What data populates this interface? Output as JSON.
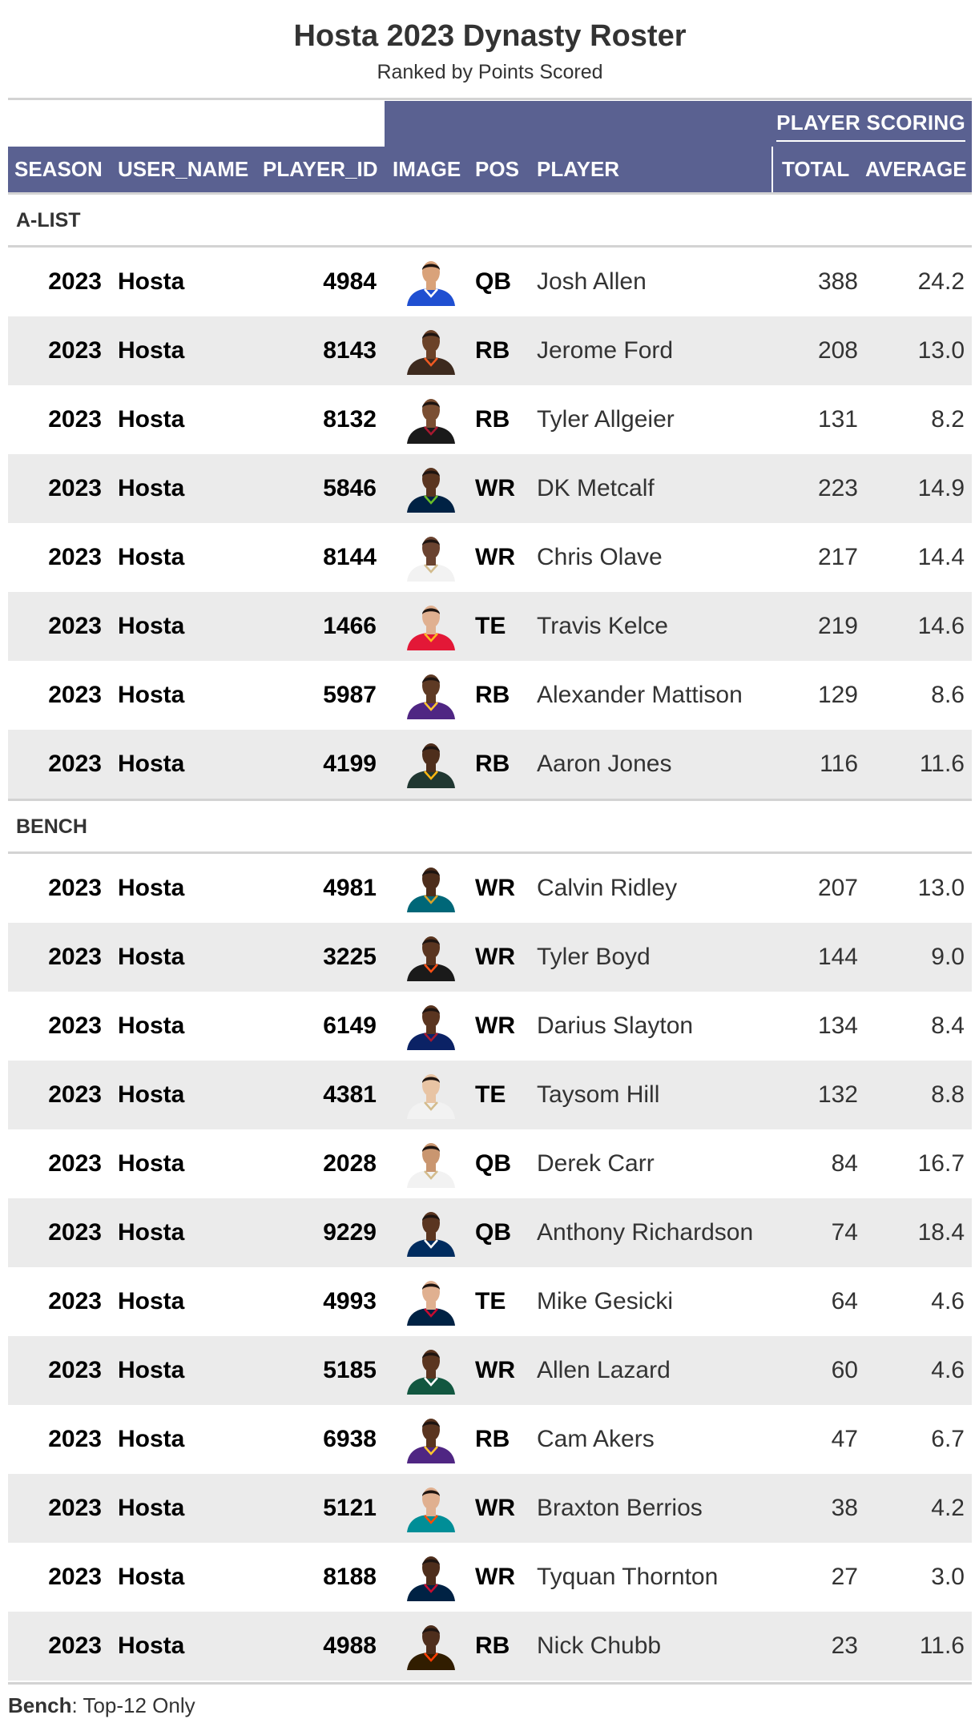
{
  "title": "Hosta 2023 Dynasty Roster",
  "subtitle": "Ranked by Points Scored",
  "spanner_label": "PLAYER SCORING",
  "columns": {
    "season": "SEASON",
    "user_name": "USER_NAME",
    "player_id": "PLAYER_ID",
    "image": "IMAGE",
    "pos": "POS",
    "player": "PLAYER",
    "total": "TOTAL",
    "average": "AVERAGE"
  },
  "groups": [
    {
      "label": "A-LIST",
      "rows": [
        {
          "season": "2023",
          "user": "Hosta",
          "pid": "4984",
          "pos": "QB",
          "player": "Josh Allen",
          "total": "388",
          "avg": "24.2",
          "jersey": "#1f4fd1",
          "trim": "#ffffff",
          "skin": "#d9a27a",
          "helmet": false
        },
        {
          "season": "2023",
          "user": "Hosta",
          "pid": "8143",
          "pos": "RB",
          "player": "Jerome Ford",
          "total": "208",
          "avg": "13.0",
          "jersey": "#3d2a1e",
          "trim": "#f05a22",
          "skin": "#6b4228",
          "helmet": false
        },
        {
          "season": "2023",
          "user": "Hosta",
          "pid": "8132",
          "pos": "RB",
          "player": "Tyler Allgeier",
          "total": "131",
          "avg": "8.2",
          "jersey": "#1a1a1a",
          "trim": "#a71930",
          "skin": "#7a4e32",
          "helmet": false
        },
        {
          "season": "2023",
          "user": "Hosta",
          "pid": "5846",
          "pos": "WR",
          "player": "DK Metcalf",
          "total": "223",
          "avg": "14.9",
          "jersey": "#002244",
          "trim": "#69be28",
          "skin": "#5a3520",
          "helmet": false
        },
        {
          "season": "2023",
          "user": "Hosta",
          "pid": "8144",
          "pos": "WR",
          "player": "Chris Olave",
          "total": "217",
          "avg": "14.4",
          "jersey": "#f2f2f2",
          "trim": "#d3bc8d",
          "skin": "#6a4330",
          "helmet": false
        },
        {
          "season": "2023",
          "user": "Hosta",
          "pid": "1466",
          "pos": "TE",
          "player": "Travis Kelce",
          "total": "219",
          "avg": "14.6",
          "jersey": "#e31837",
          "trim": "#ffb81c",
          "skin": "#e0b090",
          "helmet": false
        },
        {
          "season": "2023",
          "user": "Hosta",
          "pid": "5987",
          "pos": "RB",
          "player": "Alexander Mattison",
          "total": "129",
          "avg": "8.6",
          "jersey": "#4f2683",
          "trim": "#ffc62f",
          "skin": "#5e3a24",
          "helmet": false
        },
        {
          "season": "2023",
          "user": "Hosta",
          "pid": "4199",
          "pos": "RB",
          "player": "Aaron Jones",
          "total": "116",
          "avg": "11.6",
          "jersey": "#203731",
          "trim": "#ffb612",
          "skin": "#4e2e1c",
          "helmet": false
        }
      ]
    },
    {
      "label": "BENCH",
      "rows": [
        {
          "season": "2023",
          "user": "Hosta",
          "pid": "4981",
          "pos": "WR",
          "player": "Calvin Ridley",
          "total": "207",
          "avg": "13.0",
          "jersey": "#006778",
          "trim": "#d7a22a",
          "skin": "#4e2e1c",
          "helmet": false
        },
        {
          "season": "2023",
          "user": "Hosta",
          "pid": "3225",
          "pos": "WR",
          "player": "Tyler Boyd",
          "total": "144",
          "avg": "9.0",
          "jersey": "#1a1a1a",
          "trim": "#fb4f14",
          "skin": "#5a3520",
          "helmet": false
        },
        {
          "season": "2023",
          "user": "Hosta",
          "pid": "6149",
          "pos": "WR",
          "player": "Darius Slayton",
          "total": "134",
          "avg": "8.4",
          "jersey": "#0b2265",
          "trim": "#a71930",
          "skin": "#5a3520",
          "helmet": false
        },
        {
          "season": "2023",
          "user": "Hosta",
          "pid": "4381",
          "pos": "TE",
          "player": "Taysom Hill",
          "total": "132",
          "avg": "8.8",
          "jersey": "#f2f2f2",
          "trim": "#d3bc8d",
          "skin": "#e8c4a4",
          "helmet": false
        },
        {
          "season": "2023",
          "user": "Hosta",
          "pid": "2028",
          "pos": "QB",
          "player": "Derek Carr",
          "total": "84",
          "avg": "16.7",
          "jersey": "#f2f2f2",
          "trim": "#d3bc8d",
          "skin": "#c99670",
          "helmet": false
        },
        {
          "season": "2023",
          "user": "Hosta",
          "pid": "9229",
          "pos": "QB",
          "player": "Anthony Richardson",
          "total": "74",
          "avg": "18.4",
          "jersey": "#002c5f",
          "trim": "#ffffff",
          "skin": "#5a3520",
          "helmet": false
        },
        {
          "season": "2023",
          "user": "Hosta",
          "pid": "4993",
          "pos": "TE",
          "player": "Mike Gesicki",
          "total": "64",
          "avg": "4.6",
          "jersey": "#002244",
          "trim": "#c60c30",
          "skin": "#e0b090",
          "helmet": false
        },
        {
          "season": "2023",
          "user": "Hosta",
          "pid": "5185",
          "pos": "WR",
          "player": "Allen Lazard",
          "total": "60",
          "avg": "4.6",
          "jersey": "#125740",
          "trim": "#ffffff",
          "skin": "#5a3520",
          "helmet": false
        },
        {
          "season": "2023",
          "user": "Hosta",
          "pid": "6938",
          "pos": "RB",
          "player": "Cam Akers",
          "total": "47",
          "avg": "6.7",
          "jersey": "#4f2683",
          "trim": "#ffc62f",
          "skin": "#5a3520",
          "helmet": false
        },
        {
          "season": "2023",
          "user": "Hosta",
          "pid": "5121",
          "pos": "WR",
          "player": "Braxton Berrios",
          "total": "38",
          "avg": "4.2",
          "jersey": "#008e97",
          "trim": "#fc4c02",
          "skin": "#e0b090",
          "helmet": false
        },
        {
          "season": "2023",
          "user": "Hosta",
          "pid": "8188",
          "pos": "WR",
          "player": "Tyquan Thornton",
          "total": "27",
          "avg": "3.0",
          "jersey": "#002244",
          "trim": "#c60c30",
          "skin": "#4e2e1c",
          "helmet": false
        },
        {
          "season": "2023",
          "user": "Hosta",
          "pid": "4988",
          "pos": "RB",
          "player": "Nick Chubb",
          "total": "23",
          "avg": "11.6",
          "jersey": "#311d00",
          "trim": "#ff3c00",
          "skin": "#4e2e1c",
          "helmet": false
        }
      ]
    }
  ],
  "footnote": {
    "bold": "Bench",
    "text": ": Top-12 Only"
  },
  "colors": {
    "header_bg": "#5a6191",
    "stripe": "#ebebeb",
    "rule": "#d3d3d3"
  }
}
